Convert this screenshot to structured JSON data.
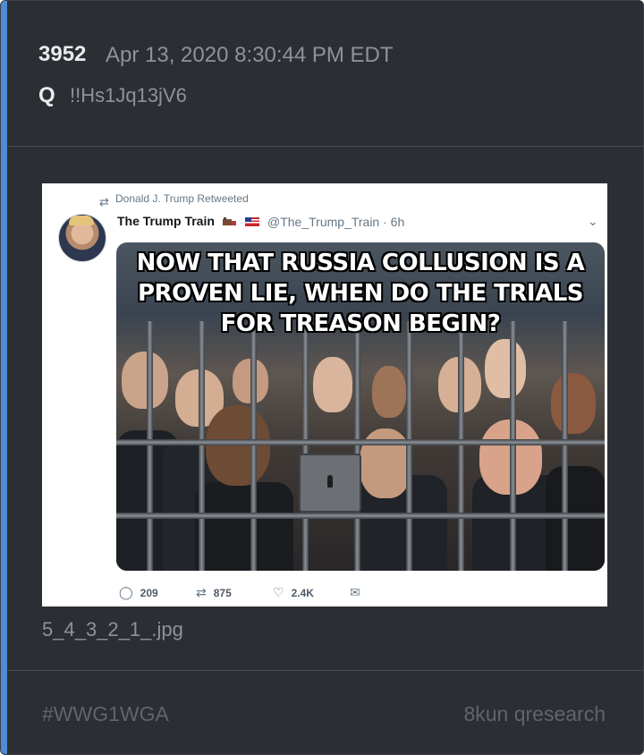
{
  "post": {
    "number": "3952",
    "date": "Apr 13, 2020 8:30:44 PM EDT",
    "author": "Q",
    "tripcode": "!!Hs1Jq13jV6"
  },
  "tweet": {
    "retweet_label": "Donald J. Trump Retweeted",
    "account_name": "The Trump Train",
    "handle_time": "@The_Trump_Train · 6h",
    "meme_lines": [
      "NOW THAT RUSSIA COLLUSION IS A",
      "PROVEN LIE, WHEN DO THE TRIALS",
      "FOR TREASON BEGIN?"
    ],
    "reply_count": "209",
    "retweet_count": "875",
    "like_count": "2.4K"
  },
  "attachment": {
    "filename": "5_4_3_2_1_.jpg"
  },
  "footer": {
    "hashtag": "#WWG1WGA",
    "source": "8kun qresearch"
  },
  "colors": {
    "accent": "#4f8bd6",
    "card_bg": "#2b2e33"
  }
}
